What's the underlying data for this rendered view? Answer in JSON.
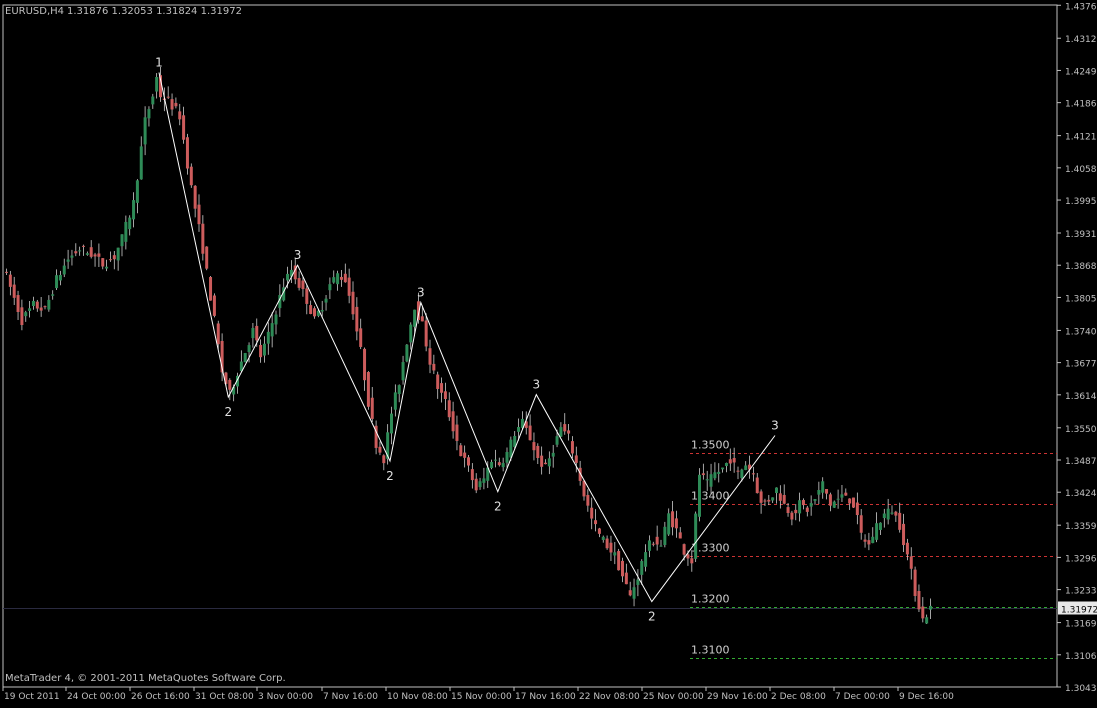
{
  "header": {
    "symbol": "EURUSD,H4",
    "ohlc": "1.31876 1.32053 1.31824 1.31972"
  },
  "footer": {
    "copyright": "MetaTrader 4, © 2001-2011 MetaQuotes Software Corp."
  },
  "colors": {
    "background": "#000000",
    "frame": "#c0c0c0",
    "text": "#c0c0c0",
    "bull_candle": "#2e8b57",
    "bear_candle": "#cd5c5c",
    "zigzag": "#ffffff",
    "resistance_line": "#cc3333",
    "support_line": "#33aa33",
    "bid_line": "#2a2a40"
  },
  "chart_data": {
    "type": "candlestick",
    "symbol": "EURUSD",
    "timeframe": "H4",
    "current_price": "1.31972",
    "ylim": [
      1.3043,
      1.4377
    ],
    "y_ticks": [
      "1.43765",
      "1.43120",
      "1.42490",
      "1.41860",
      "1.41215",
      "1.40585",
      "1.39955",
      "1.39310",
      "1.38680",
      "1.38050",
      "1.37405",
      "1.36775",
      "1.36145",
      "1.35500",
      "1.34870",
      "1.34240",
      "1.33595",
      "1.32965",
      "1.32335",
      "1.31690",
      "1.31060",
      "1.30430"
    ],
    "x_ticks": [
      "19 Oct 2011",
      "24 Oct 00:00",
      "26 Oct 16:00",
      "31 Oct 08:00",
      "3 Nov 00:00",
      "7 Nov 16:00",
      "10 Nov 08:00",
      "15 Nov 00:00",
      "17 Nov 16:00",
      "22 Nov 08:00",
      "25 Nov 00:00",
      "29 Nov 16:00",
      "2 Dec 08:00",
      "7 Dec 00:00",
      "9 Dec 16:00"
    ],
    "grid": false,
    "price_path": [
      [
        0,
        1.3865
      ],
      [
        2,
        1.3825
      ],
      [
        5,
        1.376
      ],
      [
        8,
        1.379
      ],
      [
        11,
        1.378
      ],
      [
        14,
        1.384
      ],
      [
        17,
        1.388
      ],
      [
        20,
        1.39
      ],
      [
        23,
        1.389
      ],
      [
        26,
        1.387
      ],
      [
        29,
        1.3885
      ],
      [
        31,
        1.392
      ],
      [
        34,
        1.399
      ],
      [
        37,
        1.415
      ],
      [
        39,
        1.42
      ],
      [
        40,
        1.4235
      ],
      [
        41,
        1.42
      ],
      [
        43,
        1.419
      ],
      [
        46,
        1.416
      ],
      [
        49,
        1.402
      ],
      [
        52,
        1.39
      ],
      [
        55,
        1.376
      ],
      [
        57,
        1.366
      ],
      [
        59,
        1.3615
      ],
      [
        61,
        1.366
      ],
      [
        63,
        1.37
      ],
      [
        65,
        1.374
      ],
      [
        67,
        1.369
      ],
      [
        69,
        1.373
      ],
      [
        71,
        1.378
      ],
      [
        73,
        1.383
      ],
      [
        75,
        1.386
      ],
      [
        77,
        1.383
      ],
      [
        79,
        1.38
      ],
      [
        81,
        1.376
      ],
      [
        83,
        1.379
      ],
      [
        85,
        1.383
      ],
      [
        87,
        1.385
      ],
      [
        89,
        1.384
      ],
      [
        91,
        1.378
      ],
      [
        93,
        1.37
      ],
      [
        95,
        1.36
      ],
      [
        97,
        1.352
      ],
      [
        99,
        1.349
      ],
      [
        101,
        1.358
      ],
      [
        103,
        1.364
      ],
      [
        105,
        1.372
      ],
      [
        107,
        1.379
      ],
      [
        109,
        1.375
      ],
      [
        111,
        1.368
      ],
      [
        113,
        1.363
      ],
      [
        115,
        1.36
      ],
      [
        117,
        1.355
      ],
      [
        119,
        1.35
      ],
      [
        121,
        1.347
      ],
      [
        123,
        1.343
      ],
      [
        125,
        1.345
      ],
      [
        127,
        1.349
      ],
      [
        129,
        1.348
      ],
      [
        131,
        1.35
      ],
      [
        133,
        1.354
      ],
      [
        135,
        1.356
      ],
      [
        137,
        1.353
      ],
      [
        139,
        1.349
      ],
      [
        141,
        1.347
      ],
      [
        143,
        1.351
      ],
      [
        145,
        1.355
      ],
      [
        147,
        1.353
      ],
      [
        149,
        1.348
      ],
      [
        151,
        1.342
      ],
      [
        153,
        1.337
      ],
      [
        155,
        1.334
      ],
      [
        157,
        1.332
      ],
      [
        159,
        1.33
      ],
      [
        161,
        1.326
      ],
      [
        163,
        1.322
      ],
      [
        165,
        1.326
      ],
      [
        167,
        1.331
      ],
      [
        169,
        1.333
      ],
      [
        171,
        1.332
      ],
      [
        173,
        1.338
      ],
      [
        175,
        1.335
      ],
      [
        177,
        1.331
      ],
      [
        179,
        1.329
      ],
      [
        181,
        1.346
      ],
      [
        183,
        1.344
      ],
      [
        185,
        1.346
      ],
      [
        187,
        1.347
      ],
      [
        189,
        1.349
      ],
      [
        191,
        1.346
      ],
      [
        193,
        1.348
      ],
      [
        195,
        1.346
      ],
      [
        197,
        1.34
      ],
      [
        199,
        1.341
      ],
      [
        201,
        1.343
      ],
      [
        203,
        1.34
      ],
      [
        205,
        1.338
      ],
      [
        207,
        1.34
      ],
      [
        209,
        1.339
      ],
      [
        211,
        1.341
      ],
      [
        213,
        1.344
      ],
      [
        215,
        1.34
      ],
      [
        217,
        1.341
      ],
      [
        219,
        1.342
      ],
      [
        221,
        1.34
      ],
      [
        223,
        1.334
      ],
      [
        225,
        1.332
      ],
      [
        227,
        1.336
      ],
      [
        229,
        1.338
      ],
      [
        231,
        1.339
      ],
      [
        233,
        1.336
      ],
      [
        235,
        1.33
      ],
      [
        237,
        1.323
      ],
      [
        239,
        1.3175
      ],
      [
        241,
        1.3197
      ]
    ],
    "zigzag": [
      {
        "bar": 40,
        "price": 1.4245,
        "label": "1",
        "pos": "above"
      },
      {
        "bar": 58,
        "price": 1.361,
        "label": "2",
        "pos": "below"
      },
      {
        "bar": 76,
        "price": 1.3868,
        "label": "3",
        "pos": "above"
      },
      {
        "bar": 100,
        "price": 1.3485,
        "label": "2",
        "pos": "below"
      },
      {
        "bar": 108,
        "price": 1.3795,
        "label": "3",
        "pos": "above"
      },
      {
        "bar": 128,
        "price": 1.3425,
        "label": "2",
        "pos": "below"
      },
      {
        "bar": 138,
        "price": 1.3615,
        "label": "3",
        "pos": "above"
      },
      {
        "bar": 168,
        "price": 1.321,
        "label": "2",
        "pos": "below"
      },
      {
        "bar": 200,
        "price": 1.3535,
        "label": "3",
        "pos": "above"
      }
    ],
    "horizontal_levels": [
      {
        "price": 1.35,
        "label": "1.3500",
        "kind": "resistance"
      },
      {
        "price": 1.34,
        "label": "1.3400",
        "kind": "resistance"
      },
      {
        "price": 1.33,
        "label": "1.3300",
        "kind": "resistance"
      },
      {
        "price": 1.32,
        "label": "1.3200",
        "kind": "support"
      },
      {
        "price": 1.31,
        "label": "1.3100",
        "kind": "support"
      }
    ]
  }
}
